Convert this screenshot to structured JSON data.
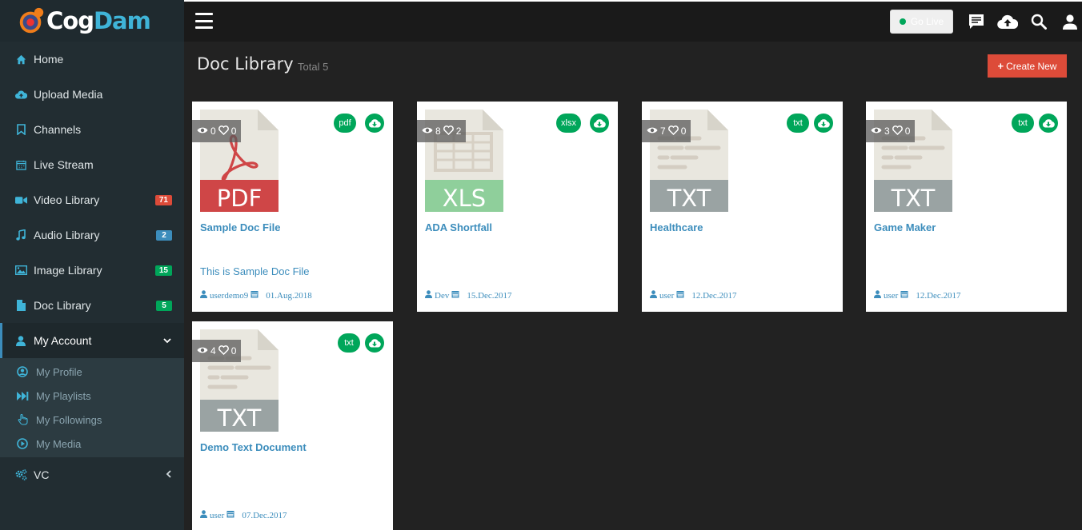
{
  "app": {
    "logo_text_a": "Cog",
    "logo_text_b": "Dam"
  },
  "sidebar": {
    "items": [
      {
        "label": "Home",
        "icon": "home-icon"
      },
      {
        "label": "Upload Media",
        "icon": "upload-icon"
      },
      {
        "label": "Channels",
        "icon": "bookmark-icon"
      },
      {
        "label": "Live Stream",
        "icon": "calendar-icon"
      },
      {
        "label": "Video Library",
        "icon": "video-icon",
        "badge": "71"
      },
      {
        "label": "Audio Library",
        "icon": "music-icon",
        "badge": "2"
      },
      {
        "label": "Image Library",
        "icon": "image-icon",
        "badge": "15"
      },
      {
        "label": "Doc Library",
        "icon": "file-icon",
        "badge": "5"
      },
      {
        "label": "My Account",
        "icon": "user-icon"
      },
      {
        "label": "VC",
        "icon": "cogs-icon"
      }
    ],
    "submenu": [
      {
        "label": "My Profile",
        "icon": "user-circle-icon"
      },
      {
        "label": "My Playlists",
        "icon": "fast-forward-icon"
      },
      {
        "label": "My Followings",
        "icon": "hand-icon"
      },
      {
        "label": "My Media",
        "icon": "play-circle-icon"
      }
    ]
  },
  "topbar": {
    "golive_label": "Go Live"
  },
  "page": {
    "title": "Doc Library",
    "subtitle": "Total 5",
    "create_label": "Create New"
  },
  "cards": [
    {
      "title": "Sample Doc File",
      "description": "This is Sample Doc File",
      "views": "0",
      "likes": "0",
      "ftype": "pdf",
      "doc_label": "PDF",
      "author": "userdemo9",
      "date": "01.Aug.2018"
    },
    {
      "title": "ADA Shortfall",
      "description": "",
      "views": "8",
      "likes": "2",
      "ftype": "xlsx",
      "doc_label": "XLS",
      "author": "Dev",
      "date": "15.Dec.2017"
    },
    {
      "title": "Healthcare",
      "description": "",
      "views": "7",
      "likes": "0",
      "ftype": "txt",
      "doc_label": "TXT",
      "author": "user",
      "date": "12.Dec.2017"
    },
    {
      "title": "Game Maker",
      "description": "",
      "views": "3",
      "likes": "0",
      "ftype": "txt",
      "doc_label": "TXT",
      "author": "user",
      "date": "12.Dec.2017"
    },
    {
      "title": "Demo Text Document",
      "description": "",
      "views": "4",
      "likes": "0",
      "ftype": "txt",
      "doc_label": "TXT",
      "author": "user",
      "date": "07.Dec.2017"
    }
  ],
  "colors": {
    "accent": "#3c8dbc",
    "danger": "#dd4b39",
    "success": "#00a65a",
    "pdf": "#cf4647",
    "xls": "#8fcf9b",
    "txt": "#9aa3a3",
    "paper": "#e9e7df"
  }
}
